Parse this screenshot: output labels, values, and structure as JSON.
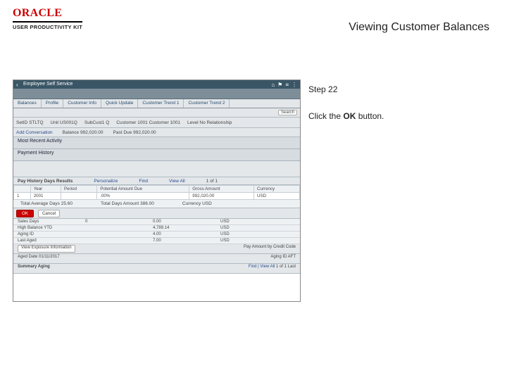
{
  "brand": {
    "logo": "ORACLE",
    "sub": "USER PRODUCTIVITY KIT"
  },
  "page_title": "Viewing Customer Balances",
  "instruction": {
    "step": "Step 22",
    "text_pre": "Click the ",
    "btn": "OK",
    "text_post": " button."
  },
  "app": {
    "header_title": "Employee Self Service",
    "top_icons": [
      "⌂",
      "⚑",
      "≡",
      "⋮"
    ],
    "tabs": [
      "Balances",
      "Profile",
      "Customer Info",
      "Quick Update",
      "Customer Trend 1",
      "Customer Trend 2"
    ],
    "search_btn": "Search",
    "id_row": {
      "setid_lbl": "SetID",
      "setid_val": "STLTQ",
      "unit_lbl": "Unit",
      "unit_val": "US001Q",
      "subcust1_lbl": "SubCust1",
      "subcust1_val": "Q",
      "cust_lbl": "Customer",
      "cust_val": "1001",
      "cust_name": "Customer 1001",
      "level_lbl": "Level",
      "level_val": "No Relationship"
    },
    "subbar": {
      "add_conv": "Add Conversation",
      "bal_lbl": "Balance",
      "bal_val": "992,020.00",
      "items_lbl": "Past Due",
      "items_val": "992,020.00"
    },
    "section1_title": "Most Recent Activity",
    "section2_title": "Payment History",
    "grid": {
      "ctrl_lbl": "Pay History Days Results",
      "personalize": "Personalize",
      "find": "Find",
      "viewall": "View All",
      "count": "1 of 1",
      "cols": [
        "Year",
        "Period",
        "Potential Amount Due",
        "Gross Amount",
        "Currency"
      ],
      "row": [
        "1",
        "2001",
        "",
        ".00%",
        "992,020.00",
        "USD"
      ]
    },
    "summary": {
      "avg_lbl": "Total Average Days",
      "avg_val": "25.60",
      "wtd_lbl": "Total Days Amount",
      "wtd_val": "386.00",
      "cur_lbl": "Currency",
      "cur_val": "USD"
    },
    "ok": "OK",
    "cancel": "Cancel",
    "kv_rows": [
      {
        "a": "Sales Days",
        "b": "0",
        "c": "0.00",
        "d": "USD"
      },
      {
        "a": "High Balance YTD",
        "b": "",
        "c": "4,789.14",
        "d": "USD"
      },
      {
        "a": "Aging ID",
        "b": "",
        "c": "4.00",
        "d": "USD"
      },
      {
        "a": "Last Aged",
        "b": "",
        "c": "7.00",
        "d": "USD"
      }
    ],
    "exposure_btn": "View Exposure Information",
    "aging_lbl": "Pay Amount by Credit Code",
    "aged_row": {
      "a": "Aged Date 01/11/2017",
      "b": "Aging ID  AFT"
    },
    "sum_aging": {
      "title": "Summary Aging",
      "find": "Find | View All",
      "count": "1 of 1   Last"
    }
  }
}
